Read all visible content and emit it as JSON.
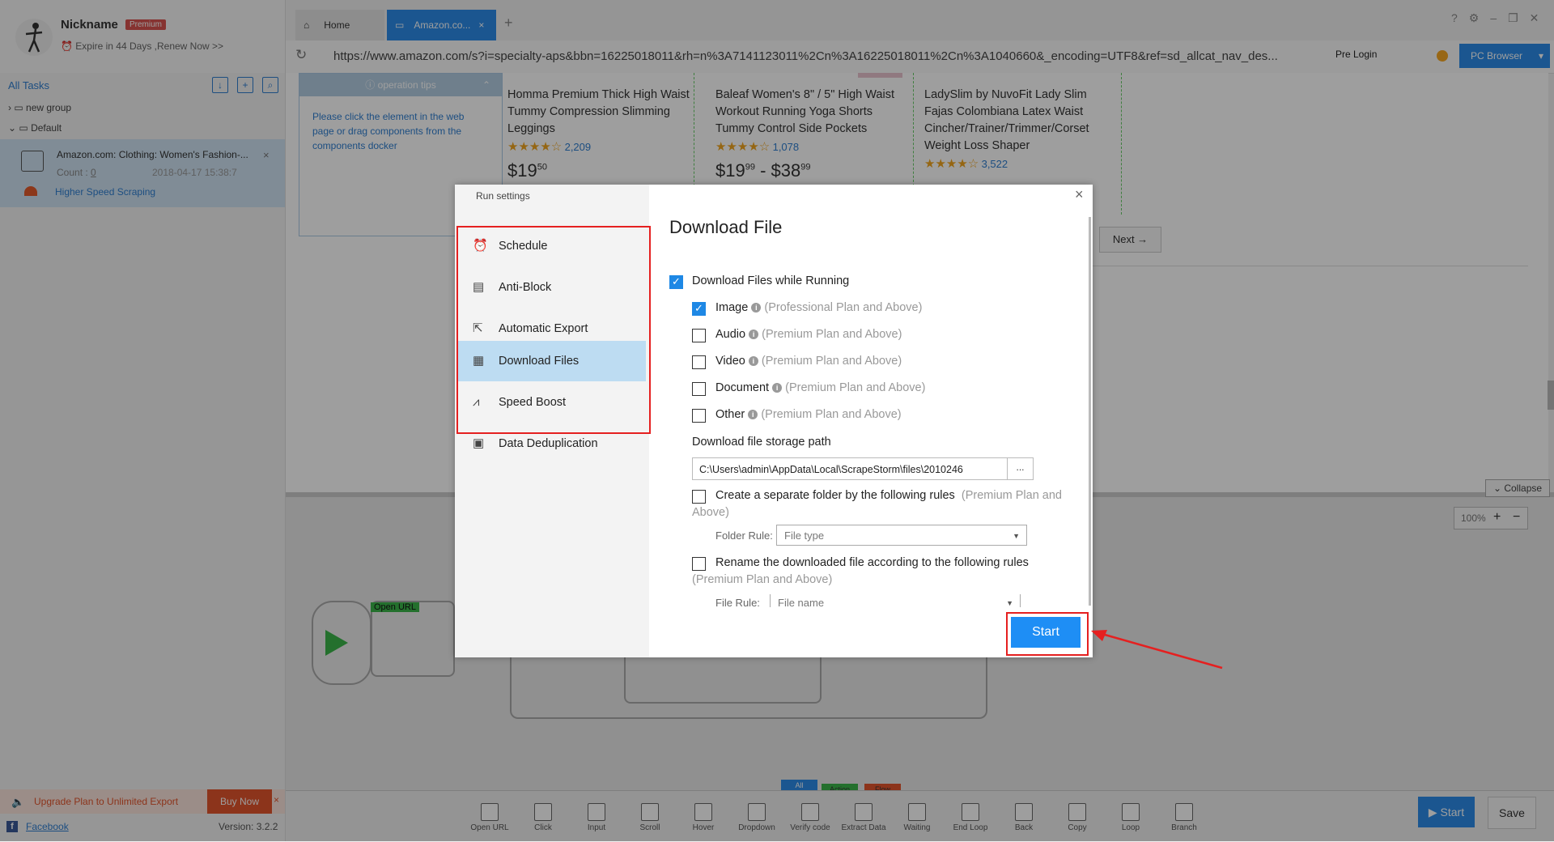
{
  "profile": {
    "nickname": "Nickname",
    "badge": "Premium",
    "expire": "Expire in 44 Days ,Renew Now >>"
  },
  "sidebar": {
    "all_tasks": "All Tasks",
    "groups": [
      "new group",
      "Default"
    ],
    "task": {
      "title": "Amazon.com: Clothing: Women's Fashion-...",
      "count_label": "Count :",
      "count": "0",
      "date": "2018-04-17 15:38:7",
      "speed": "Higher Speed Scraping"
    },
    "upgrade": "Upgrade Plan to Unlimited Export",
    "buy_now": "Buy Now",
    "facebook": "Facebook",
    "version": "Version: 3.2.2"
  },
  "tabs": [
    {
      "label": "Home"
    },
    {
      "label": "Amazon.co..."
    }
  ],
  "url": "https://www.amazon.com/s?i=specialty-aps&bbn=16225018011&rh=n%3A7141123011%2Cn%3A16225018011%2Cn%3A1040660&_encoding=UTF8&ref=sd_allcat_nav_des...",
  "top_right": {
    "pre_login": "Pre Login",
    "pc_browser": "PC Browser"
  },
  "products": [
    {
      "title": "Homma Premium Thick High Waist Tummy Compression Slimming Leggings",
      "count": "2,209",
      "price": "$19",
      "cents": "50"
    },
    {
      "title": "Baleaf Women's 8\" / 5\" High Waist Workout Running Yoga Shorts Tummy Control Side Pockets",
      "count": "1,078",
      "price": "$19",
      "cents": "99",
      "price2": "$38",
      "cents2": "99"
    },
    {
      "title": "LadySlim by NuvoFit Lady Slim Fajas Colombiana Latex Waist Cincher/Trainer/Trimmer/Corset Weight Loss Shaper",
      "count": "3,522"
    }
  ],
  "next": "Next →",
  "op_tips": {
    "title": "operation tips",
    "body": "Please click the element in the web page or drag components from the components docker"
  },
  "collapse": "Collapse",
  "zoom": "100%",
  "flow": {
    "open_url": "Open URL",
    "tabs": [
      "All",
      "Action",
      "Flow"
    ]
  },
  "toolbar": {
    "items": [
      "Open URL",
      "Click",
      "Input",
      "Scroll",
      "Hover",
      "Dropdown",
      "Verify code",
      "Extract Data",
      "Waiting",
      "End Loop",
      "Back",
      "Copy",
      "Loop",
      "Branch"
    ],
    "start": "Start",
    "save": "Save"
  },
  "dialog": {
    "title": "Run settings",
    "nav": [
      "Schedule",
      "Anti-Block",
      "Automatic Export",
      "Download Files",
      "Speed Boost",
      "Data Deduplication"
    ],
    "heading": "Download File",
    "download_while_running": "Download Files while Running",
    "options": [
      {
        "label": "Image",
        "hint": "(Professional Plan and Above)",
        "checked": true
      },
      {
        "label": "Audio",
        "hint": "(Premium Plan and Above)",
        "checked": false
      },
      {
        "label": "Video",
        "hint": "(Premium Plan and Above)",
        "checked": false
      },
      {
        "label": "Document",
        "hint": "(Premium Plan and Above)",
        "checked": false
      },
      {
        "label": "Other",
        "hint": "(Premium Plan and Above)",
        "checked": false
      }
    ],
    "path_label": "Download file storage path",
    "path_value": "C:\\Users\\admin\\AppData\\Local\\ScrapeStorm\\files\\2010246",
    "path_button": "...",
    "separate_folder": "Create a separate folder by the following rules",
    "separate_hint_1": "(Premium Plan and",
    "separate_hint_2": "Above)",
    "folder_rule_label": "Folder Rule:",
    "folder_rule_value": "File type",
    "rename": "Rename the downloaded file according to the following rules",
    "rename_hint": "(Premium Plan and Above)",
    "file_rule_label": "File Rule:",
    "file_rule_value": "File name",
    "start": "Start"
  },
  "colors": {
    "accent": "#1e8ef5",
    "highlight": "#e52020",
    "nav_active": "#bddcf2"
  }
}
